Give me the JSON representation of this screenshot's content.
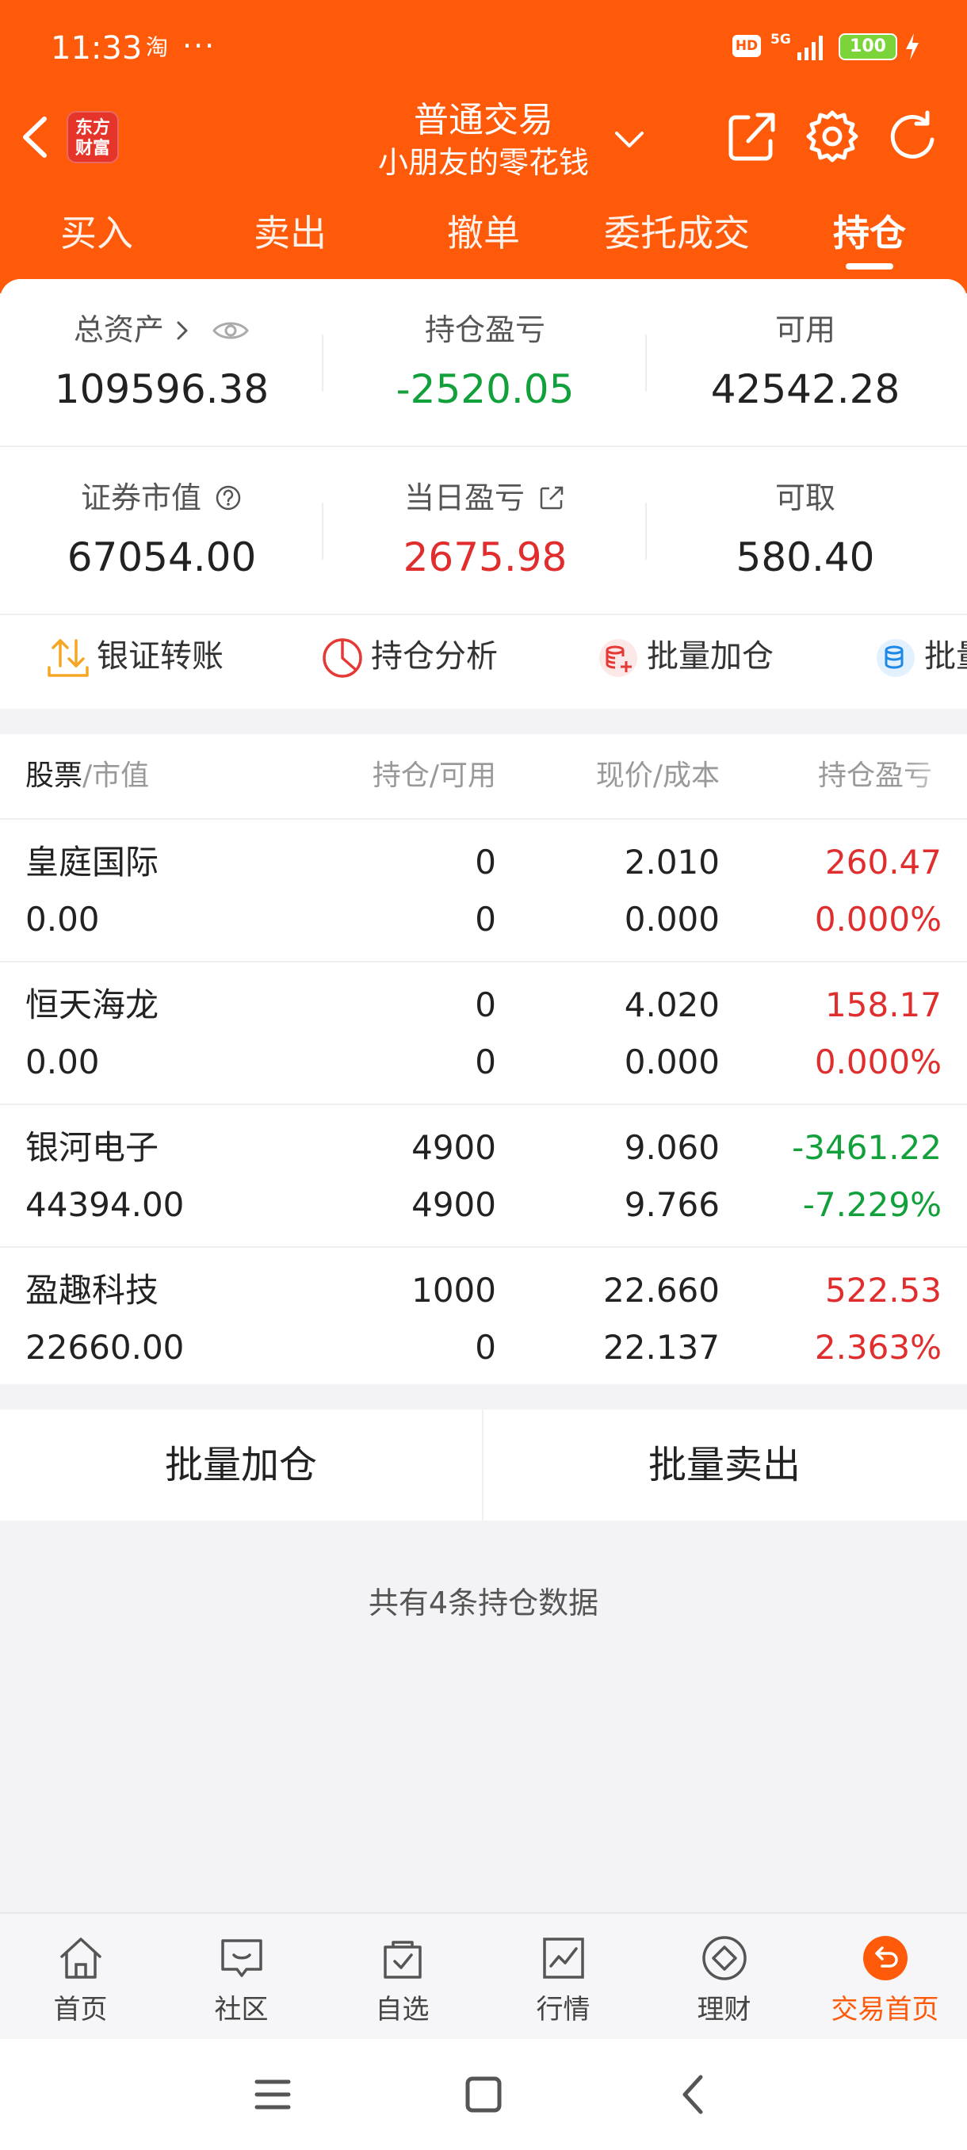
{
  "status_bar": {
    "time": "11:33",
    "app_glyph": "淘",
    "dots": "···",
    "hd": "HD",
    "network": "5G",
    "battery": "100"
  },
  "nav": {
    "title": "普通交易",
    "subtitle": "小朋友的零花钱",
    "logo_line1": "东方",
    "logo_line2": "财富"
  },
  "tabs": [
    {
      "label": "买入"
    },
    {
      "label": "卖出"
    },
    {
      "label": "撤单"
    },
    {
      "label": "委托成交"
    },
    {
      "label": "持仓"
    }
  ],
  "summary": {
    "total_assets_label": "总资产",
    "total_assets": "109596.38",
    "holding_pnl_label": "持仓盈亏",
    "holding_pnl": "-2520.05",
    "available_label": "可用",
    "available": "42542.28",
    "market_value_label": "证券市值",
    "market_value": "67054.00",
    "daily_pnl_label": "当日盈亏",
    "daily_pnl": "2675.98",
    "withdrawable_label": "可取",
    "withdrawable": "580.40"
  },
  "actions": [
    {
      "label": "银证转账"
    },
    {
      "label": "持仓分析"
    },
    {
      "label": "批量加仓"
    },
    {
      "label": "批量"
    }
  ],
  "table": {
    "headers": {
      "stock": "股票",
      "market_value": "/市值",
      "holding": "持仓/可用",
      "price": "现价/成本",
      "pnl": "持仓盈亏"
    },
    "rows": [
      {
        "name": "皇庭国际",
        "mv": "0.00",
        "hold": "0",
        "avail": "0",
        "price": "2.010",
        "cost": "0.000",
        "pnl": "260.47",
        "pct": "0.000%"
      },
      {
        "name": "恒天海龙",
        "mv": "0.00",
        "hold": "0",
        "avail": "0",
        "price": "4.020",
        "cost": "0.000",
        "pnl": "158.17",
        "pct": "0.000%"
      },
      {
        "name": "银河电子",
        "mv": "44394.00",
        "hold": "4900",
        "avail": "4900",
        "price": "9.060",
        "cost": "9.766",
        "pnl": "-3461.22",
        "pct": "-7.229%"
      },
      {
        "name": "盈趣科技",
        "mv": "22660.00",
        "hold": "1000",
        "avail": "0",
        "price": "22.660",
        "cost": "22.137",
        "pnl": "522.53",
        "pct": "2.363%"
      }
    ]
  },
  "buttons": {
    "batch_add": "批量加仓",
    "batch_sell": "批量卖出"
  },
  "footer_text": "共有4条持仓数据",
  "bottom_nav": [
    {
      "label": "首页"
    },
    {
      "label": "社区"
    },
    {
      "label": "自选"
    },
    {
      "label": "行情"
    },
    {
      "label": "理财"
    },
    {
      "label": "交易首页"
    }
  ],
  "colors": {
    "brand": "#ff5a0a",
    "up": "#e02e2e",
    "down": "#11a03a"
  }
}
